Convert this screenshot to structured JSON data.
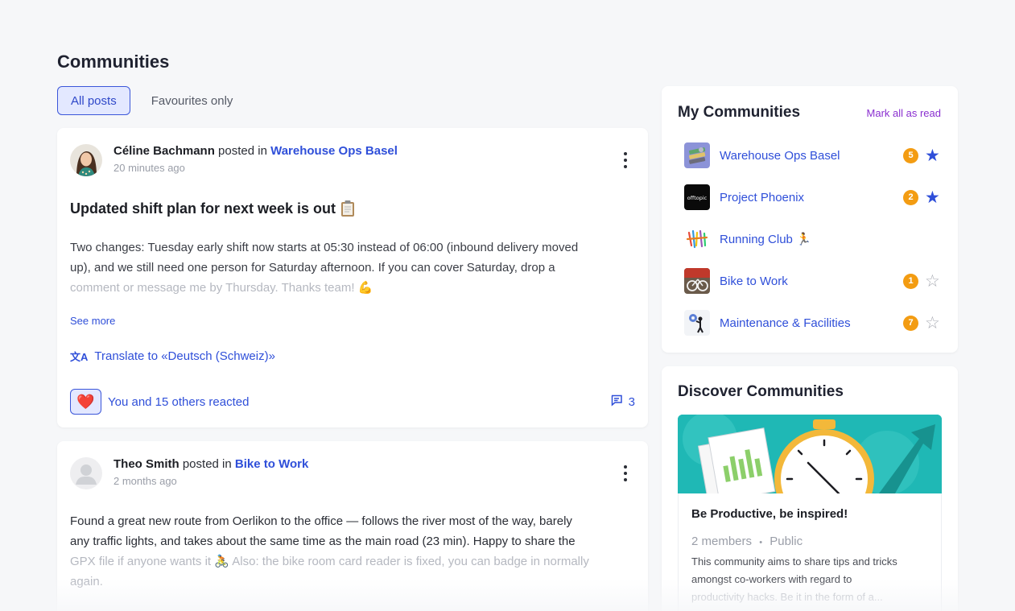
{
  "page": {
    "title": "Communities"
  },
  "tabs": [
    {
      "label": "All posts",
      "active": true
    },
    {
      "label": "Favourites only",
      "active": false
    }
  ],
  "posts": [
    {
      "author": "Céline Bachmann",
      "posted_in": " posted in ",
      "community": "Warehouse Ops Basel",
      "time": "20 minutes ago",
      "title": "Updated shift plan for next week is out",
      "title_icon": "clipboard-icon",
      "body_lines": [
        "Two changes: Tuesday early shift now starts at 05:30 instead of 06:00 (inbound delivery moved",
        "up), and we still need one person for Saturday afternoon. If you can cover Saturday, drop a",
        "comment or message me by Thursday. Thanks team! 💪"
      ],
      "see_more": "See more",
      "translate": "Translate to «Deutsch (Schweiz)»",
      "reaction_emoji": "❤️",
      "reaction_text": "You and 15 others reacted",
      "comment_count": "3"
    },
    {
      "author": "Theo Smith",
      "posted_in": " posted in ",
      "community": "Bike to Work",
      "time": "2 months ago",
      "body_lines": [
        "Found a great new route from Oerlikon to the office — follows the river most of the way, barely",
        "any traffic lights, and takes about the same time as the main road (23 min). Happy to share the",
        "GPX file if anyone wants it 🚴 Also: the bike room card reader is fixed, you can badge in normally",
        "again."
      ]
    }
  ],
  "my_communities": {
    "title": "My Communities",
    "mark_all_read": "Mark all as read",
    "items": [
      {
        "name": "Warehouse Ops Basel",
        "badge": "5",
        "favourite": true,
        "thumb": "warehouse-thumb"
      },
      {
        "name": "Project Phoenix",
        "badge": "2",
        "favourite": true,
        "thumb": "offtopic-thumb",
        "thumb_text": "offtopic"
      },
      {
        "name": "Running Club 🏃",
        "badge": "",
        "favourite": null,
        "thumb": "running-thumb"
      },
      {
        "name": "Bike to Work",
        "badge": "1",
        "favourite": false,
        "thumb": "bike-thumb"
      },
      {
        "name": "Maintenance & Facilities",
        "badge": "7",
        "favourite": false,
        "thumb": "maintenance-thumb"
      }
    ]
  },
  "discover": {
    "title": "Discover Communities",
    "card": {
      "name": "Be Productive, be inspired!",
      "members": "2 members",
      "separator": "•",
      "visibility": "Public",
      "desc_lines": [
        "This community aims to share tips and tricks",
        "amongst co-workers with regard to",
        "productivity hacks. Be it in the form of a..."
      ]
    }
  },
  "colors": {
    "accent": "#2f4fd9",
    "badge": "#f39c12",
    "mark_read": "#8a2fd0",
    "banner": "#1fb8b5"
  }
}
